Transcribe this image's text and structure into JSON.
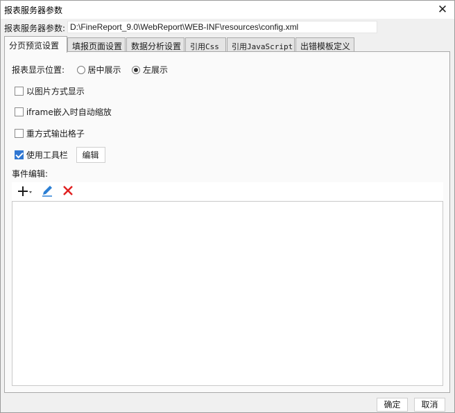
{
  "window": {
    "title": "报表服务器参数",
    "close_glyph": "✕"
  },
  "server": {
    "label": "报表服务器参数:",
    "path": "D:\\FineReport_9.0\\WebReport\\WEB-INF\\resources\\config.xml"
  },
  "tabs": [
    {
      "label": "分页预览设置",
      "active": true
    },
    {
      "label": "填报页面设置"
    },
    {
      "label": "数据分析设置"
    },
    {
      "label": "引用Css"
    },
    {
      "label": "引用JavaScript"
    },
    {
      "label": "出错模板定义"
    }
  ],
  "preview": {
    "position_label": "报表显示位置:",
    "position_options": [
      {
        "label": "居中展示",
        "selected": false
      },
      {
        "label": "左展示",
        "selected": true
      }
    ],
    "checkboxes": [
      {
        "label": "以图片方式显示",
        "checked": false
      },
      {
        "label": "iframe嵌入时自动缩放",
        "checked": false
      },
      {
        "label": "重方式输出格子",
        "checked": false
      },
      {
        "label": "使用工具栏",
        "checked": true
      }
    ],
    "toolbar_edit_button": "编辑",
    "event_label": "事件编辑:",
    "event_tools": [
      "add-icon",
      "edit-pencil-icon",
      "delete-x-icon"
    ],
    "event_list": []
  },
  "footer": {
    "ok": "确定",
    "cancel": "取消"
  },
  "colors": {
    "accent": "#3077d2",
    "delete": "#e02020",
    "pencil": "#2b7fd4"
  }
}
